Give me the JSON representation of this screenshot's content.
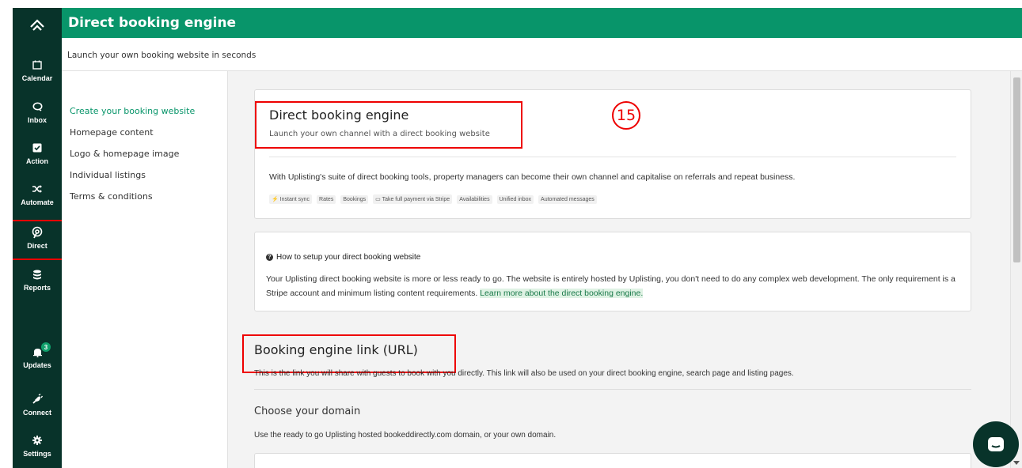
{
  "header": {
    "title": "Direct booking engine",
    "subtitle": "Launch your own booking website in seconds"
  },
  "nav": {
    "logo_icon": "chevrons-up-logo-icon",
    "items": [
      {
        "label": "Calendar",
        "icon": "calendar-icon"
      },
      {
        "label": "Inbox",
        "icon": "chat-bubble-icon"
      },
      {
        "label": "Action",
        "icon": "checkbox-icon"
      },
      {
        "label": "Automate",
        "icon": "shuffle-icon"
      },
      {
        "label": "Direct",
        "icon": "direct-icon",
        "active": true
      },
      {
        "label": "Reports",
        "icon": "database-icon"
      },
      {
        "label": "Updates",
        "icon": "bell-icon",
        "badge": "3"
      },
      {
        "label": "Connect",
        "icon": "plug-icon"
      },
      {
        "label": "Settings",
        "icon": "gear-icon"
      }
    ]
  },
  "sidebar": {
    "items": [
      {
        "label": "Create your booking website",
        "active": true
      },
      {
        "label": "Homepage content"
      },
      {
        "label": "Logo & homepage image"
      },
      {
        "label": "Individual listings"
      },
      {
        "label": "Terms & conditions"
      }
    ]
  },
  "intro_card": {
    "title": "Direct booking engine",
    "subtitle": "Launch your own channel with a direct booking website",
    "annotation": "15",
    "description": "With Uplisting's suite of direct booking tools, property managers can become their own channel and capitalise on referrals and repeat business.",
    "tags": [
      "Instant sync",
      "Rates",
      "Bookings",
      "Take full payment via Stripe",
      "Availabilities",
      "Unified inbox",
      "Automated messages"
    ]
  },
  "setup_card": {
    "heading": "How to setup your direct booking website",
    "text": "Your Uplisting direct booking website is more or less ready to go. The website is entirely hosted by Uplisting, you don't need to do any complex web development. The only requirement is a Stripe account and minimum listing content requirements.",
    "link": "Learn more about the direct booking engine."
  },
  "booking_link": {
    "title": "Booking engine link (URL)",
    "description": "This is the link you will share with guests to book with you directly. This link will also be used on your direct booking engine, search page and listing pages."
  },
  "domain": {
    "title": "Choose your domain",
    "description": "Use the ready to go Uplisting hosted bookeddirectly.com domain, or your own domain."
  },
  "colors": {
    "nav_bg": "#08332a",
    "header_bg": "#08956a",
    "accent": "#08956a",
    "highlight": "#e00000"
  }
}
